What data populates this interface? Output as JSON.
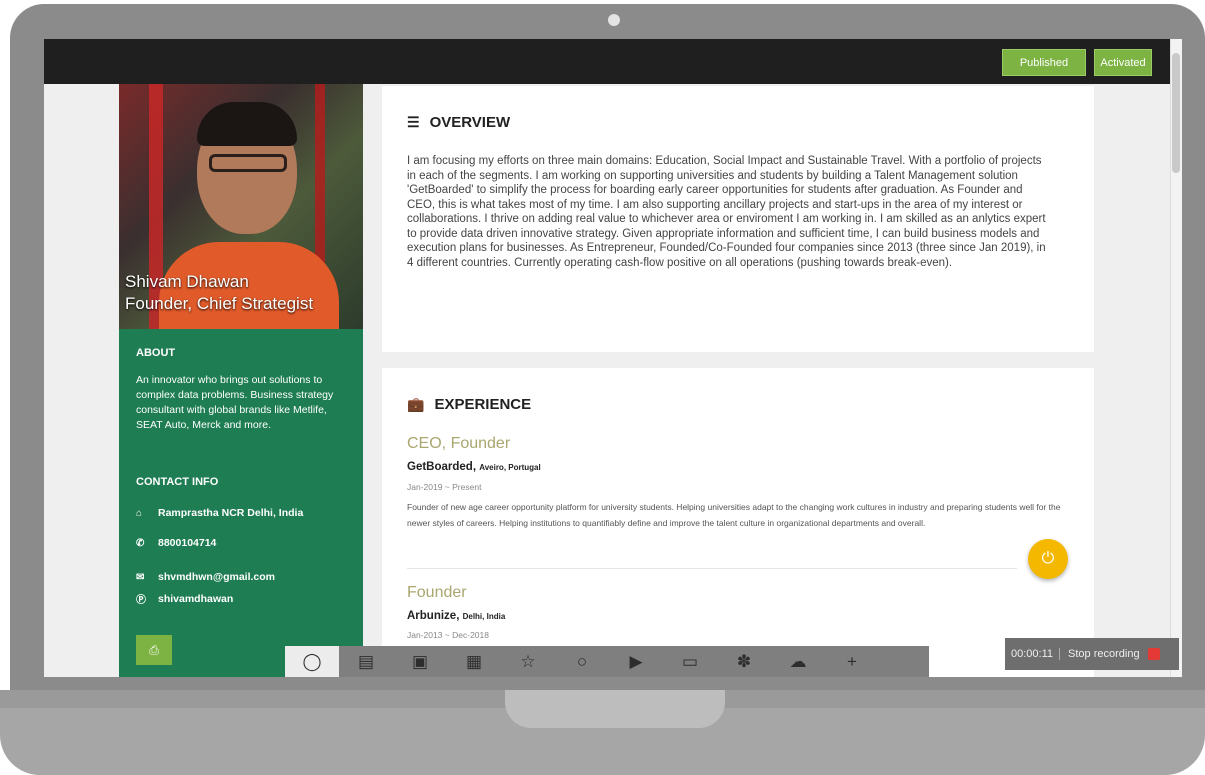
{
  "topbar": {
    "published_label": "Published",
    "activated_label": "Activated"
  },
  "profile": {
    "name": "Shivam Dhawan",
    "role": "Founder, Chief Strategist"
  },
  "about": {
    "heading": "ABOUT",
    "text": "An innovator who brings out solutions to complex data problems. Business strategy consultant with global brands like Metlife, SEAT Auto, Merck and more."
  },
  "contact": {
    "heading": "CONTACT INFO",
    "location": "Ramprastha NCR Delhi, India",
    "phone": "8800104714",
    "email": "shvmdhwn@gmail.com",
    "skype": "shivamdhawan"
  },
  "overview": {
    "heading": "OVERVIEW",
    "text": "I am focusing my efforts on three main domains: Education, Social Impact and Sustainable Travel. With a portfolio of projects in each of the segments. I am working on supporting universities and students by building a Talent Management solution 'GetBoarded' to simplify the process for boarding early career opportunities for students after graduation. As Founder and CEO, this is what takes most of my time. I am also supporting ancillary projects and start-ups in the area of my interest or collaborations. I thrive on adding real value to whichever area or enviroment I am working in. I am skilled as an anlytics expert to provide data driven innovative strategy. Given appropriate information and sufficient time, I can build business models and execution plans for businesses. As Entrepreneur, Founded/Co-Founded four companies since 2013 (three since Jan 2019), in 4 different countries. Currently operating cash-flow positive on all operations (pushing towards break-even)."
  },
  "experience": {
    "heading": "EXPERIENCE",
    "jobs": [
      {
        "title": "CEO, Founder",
        "company": "GetBoarded,",
        "location": "Aveiro, Portugal",
        "dates": "Jan-2019 ~ Present",
        "description": "Founder of new age career opportunity platform for university students. Helping universities adapt to the changing work cultures in industry and preparing students well for the newer styles of careers. Helping institutions to quantifiably define and improve the talent culture in organizational departments and overall."
      },
      {
        "title": "Founder",
        "company": "Arbunize,",
        "location": "Delhi, India",
        "dates": "Jan-2013 ~ Dec-2018"
      }
    ]
  },
  "dock": {
    "icons": [
      "person-icon",
      "id-card-icon",
      "document-icon",
      "document-edit-icon",
      "star-icon",
      "chat-bubble-icon",
      "video-icon",
      "folder-icon",
      "award-icon",
      "cloud-upload-icon",
      "plus-icon"
    ]
  },
  "recording": {
    "time": "00:00:11",
    "stop_label": "Stop recording"
  },
  "colors": {
    "sidebar": "#1e7d52",
    "accent_green": "#7cb342",
    "fab": "#f5b800",
    "job_title": "#a9a66f"
  }
}
